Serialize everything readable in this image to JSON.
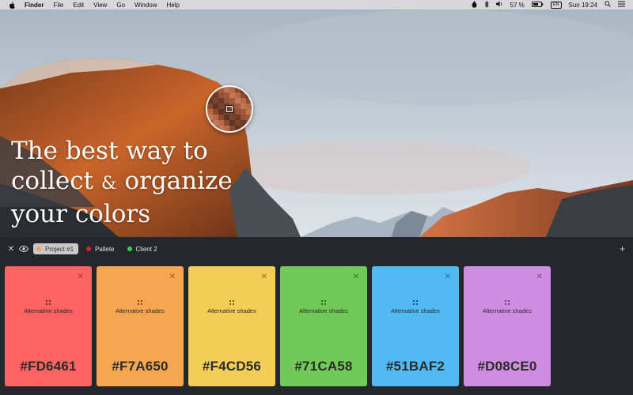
{
  "menubar": {
    "apple_icon": "apple-logo-icon",
    "app_name": "Finder",
    "menus": [
      "File",
      "Edit",
      "View",
      "Go",
      "Window",
      "Help"
    ],
    "status": {
      "battery_percent": "57 %",
      "clock": "Sun 19:24",
      "input_source": "EN"
    }
  },
  "hero": {
    "headline_line1": "The best way to",
    "headline_line2a": "collect",
    "headline_amp": "&",
    "headline_line2b": "organize",
    "headline_line3": "your colors"
  },
  "toolbar": {
    "tabs": [
      {
        "label": "Project #1",
        "color": "#F5A15A",
        "active": true
      },
      {
        "label": "Pallete",
        "color": "#E2231A",
        "active": false
      },
      {
        "label": "Client 2",
        "color": "#39D353",
        "active": false
      }
    ],
    "add_label": "+"
  },
  "swatches": [
    {
      "hex": "#FD6461",
      "color": "#FD6461",
      "subtitle": "Alternative shades"
    },
    {
      "hex": "#F7A650",
      "color": "#F7A650",
      "subtitle": "Alternative shades"
    },
    {
      "hex": "#F4CD56",
      "color": "#F4CD56",
      "subtitle": "Alternative shades"
    },
    {
      "hex": "#71CA58",
      "color": "#71CA58",
      "subtitle": "Alternative shades"
    },
    {
      "hex": "#51BAF2",
      "color": "#51BAF2",
      "subtitle": "Alternative shades"
    },
    {
      "hex": "#D08CE0",
      "color": "#D08CE0",
      "subtitle": "Alternative shades"
    }
  ]
}
